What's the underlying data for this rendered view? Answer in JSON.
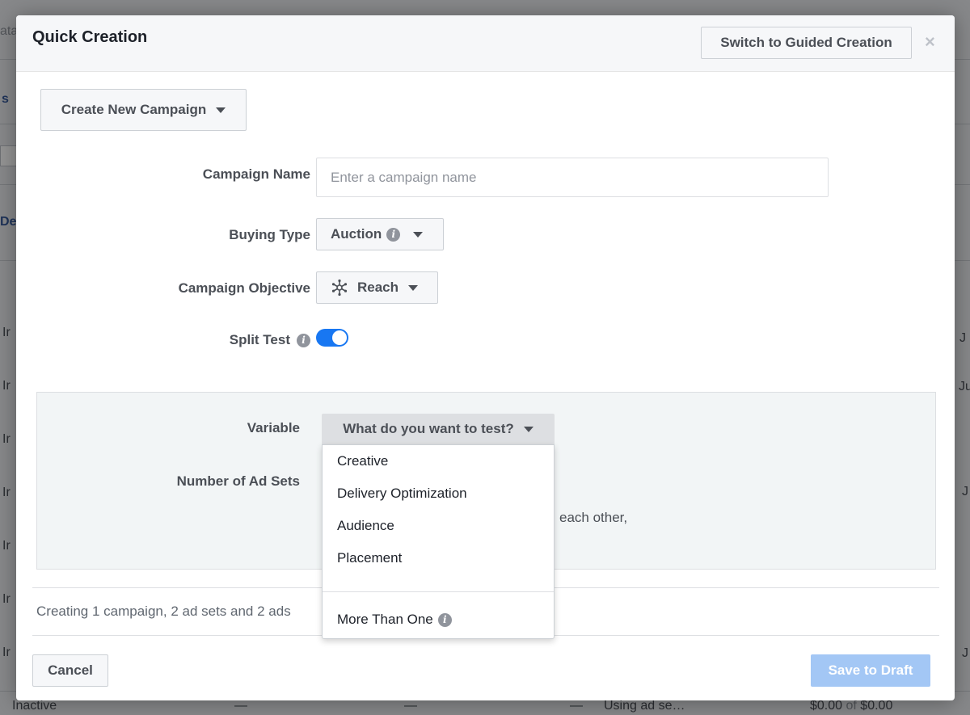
{
  "background": {
    "fragments": [
      "ata",
      "s",
      "De",
      "Ir",
      "Ir",
      "Ir",
      "Ir",
      "Ir",
      "Ir",
      "Ir",
      "Inactive",
      "—",
      "—",
      "—",
      "Using ad se…",
      "$0.00",
      "of",
      "$0.00",
      "J",
      "Ju",
      "J",
      "J"
    ]
  },
  "modal": {
    "title": "Quick Creation",
    "switch_label": "Switch to Guided Creation",
    "close_label": "×"
  },
  "campaign": {
    "create_label": "Create New Campaign",
    "name_label": "Campaign Name",
    "name_placeholder": "Enter a campaign name",
    "buying_type_label": "Buying Type",
    "buying_type_value": "Auction",
    "objective_label": "Campaign Objective",
    "objective_value": "Reach",
    "split_test_label": "Split Test",
    "split_test_on": true
  },
  "split_test": {
    "variable_label": "Variable",
    "variable_placeholder": "What do you want to test?",
    "ad_sets_label": "Number of Ad Sets",
    "partial_text": "each other,"
  },
  "dropdown": {
    "items": [
      "Creative",
      "Delivery Optimization",
      "Audience",
      "Placement"
    ],
    "more_label": "More Than One"
  },
  "footer": {
    "summary": "Creating 1 campaign, 2 ad sets and 2 ads",
    "cancel_label": "Cancel",
    "save_label": "Save to Draft"
  },
  "icons": {
    "info": "info-icon",
    "reach": "reach-icon",
    "caret": "caret-down-icon",
    "close": "close-icon"
  },
  "colors": {
    "toggle_on": "#1877f2",
    "save_disabled": "#a3c7f5",
    "link_blue": "#365899"
  }
}
